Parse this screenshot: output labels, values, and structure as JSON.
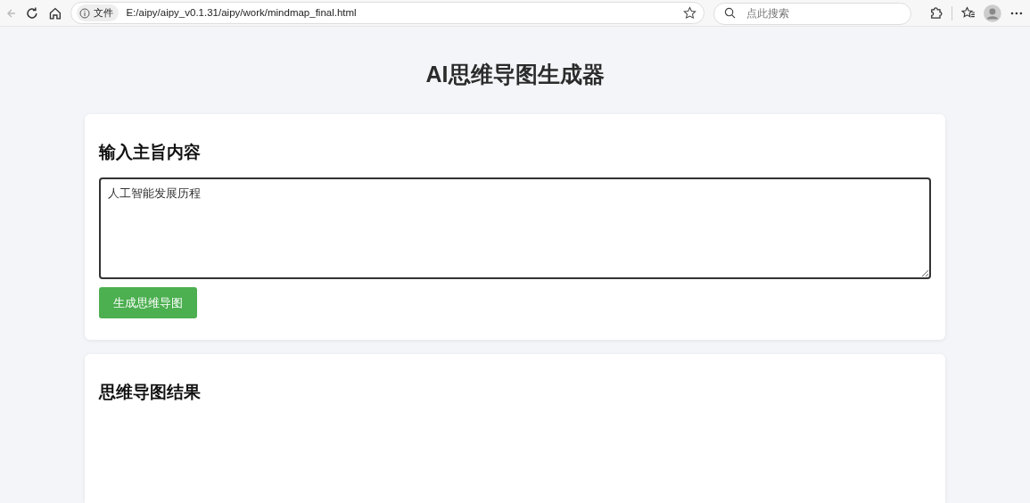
{
  "browser": {
    "scheme_label": "文件",
    "url": "E:/aipy/aipy_v0.1.31/aipy/work/mindmap_final.html",
    "search": {
      "placeholder": "点此搜索"
    }
  },
  "page": {
    "title": "AI思维导图生成器",
    "input_card": {
      "heading": "输入主旨内容",
      "textarea": {
        "value": "人工智能发展历程"
      },
      "button": "生成思维导图"
    },
    "result_card": {
      "heading": "思维导图结果"
    }
  }
}
